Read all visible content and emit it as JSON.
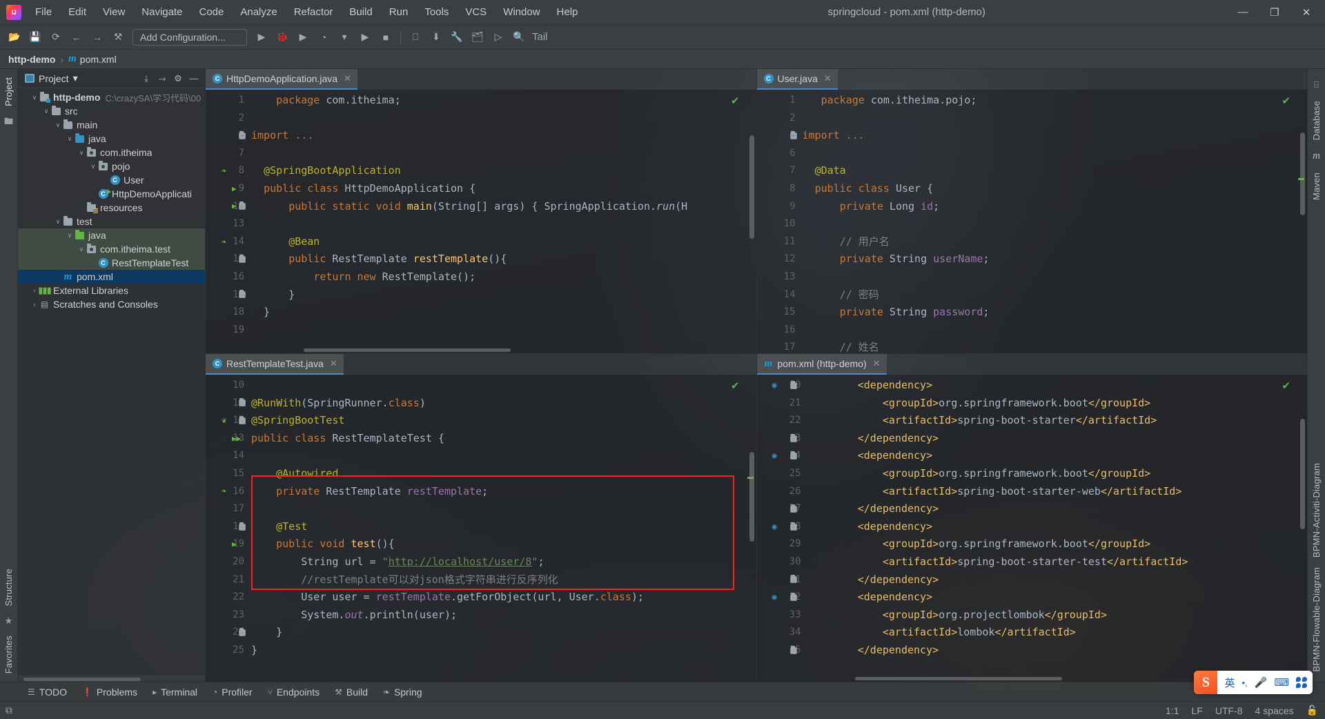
{
  "window": {
    "title": "springcloud - pom.xml (http-demo)",
    "logo_text": "IJ",
    "minimize": "—",
    "maximize": "❐",
    "close": "✕"
  },
  "menu": {
    "items": [
      "File",
      "Edit",
      "View",
      "Navigate",
      "Code",
      "Analyze",
      "Refactor",
      "Build",
      "Run",
      "Tools",
      "VCS",
      "Window",
      "Help"
    ]
  },
  "toolbar": {
    "icons": [
      {
        "name": "open-folder-icon",
        "glyph": "📂"
      },
      {
        "name": "save-all-icon",
        "glyph": "💾"
      },
      {
        "name": "sync-icon",
        "glyph": "⟳"
      },
      {
        "name": "back-icon",
        "glyph": "←"
      },
      {
        "name": "forward-icon",
        "glyph": "→"
      },
      {
        "name": "build-hammer-icon",
        "glyph": "⚒"
      }
    ],
    "config_label": "Add Configuration...",
    "run_icons": [
      {
        "name": "run-icon",
        "glyph": "▶"
      },
      {
        "name": "debug-icon",
        "glyph": "🐞"
      },
      {
        "name": "run-with-coverage-icon",
        "glyph": "▶"
      },
      {
        "name": "profile-icon",
        "glyph": "◔"
      },
      {
        "name": "dropdown-arrow-icon",
        "glyph": "▾"
      },
      {
        "name": "run-again-icon",
        "glyph": "▶"
      },
      {
        "name": "stop-icon",
        "glyph": "■"
      }
    ],
    "extra_icons": [
      {
        "name": "device-manager-icon",
        "glyph": "⎕"
      },
      {
        "name": "update-project-icon",
        "glyph": "⬇"
      },
      {
        "name": "settings-wrench-icon",
        "glyph": "🔧"
      },
      {
        "name": "project-structure-icon",
        "glyph": "🗂"
      },
      {
        "name": "terminal-icon",
        "glyph": "▷"
      },
      {
        "name": "search-everywhere-icon",
        "glyph": "🔍"
      }
    ],
    "tail_label": "Tail"
  },
  "breadcrumb": {
    "project": "http-demo",
    "separator": "›",
    "file": "pom.xml",
    "maven_glyph": "m"
  },
  "left_strip": {
    "top_label": "Project",
    "bottom_labels": [
      "Structure",
      "Favorites"
    ],
    "folder_icon": "🖿",
    "star_icon": "★"
  },
  "right_strip": {
    "labels": [
      "Database",
      "Maven",
      "BPMN-Activiti-Diagram",
      "BPMN-Flowable-Diagram"
    ],
    "database_icon": "⌸",
    "maven_glyph": "m"
  },
  "project_panel": {
    "title": "Project",
    "chevron": "▾",
    "actions": [
      {
        "name": "expand-all-icon",
        "glyph": "⤓"
      },
      {
        "name": "collapse-all-icon",
        "glyph": "⤑"
      },
      {
        "name": "settings-gear-icon",
        "glyph": "⚙"
      },
      {
        "name": "hide-panel-icon",
        "glyph": "—"
      }
    ],
    "tree": [
      {
        "label": "http-demo",
        "note": "C:\\crazySA\\学习代码\\00",
        "depth": 0,
        "arrow": "∨",
        "icon": "module-folder-icon",
        "bold": true,
        "state": "none"
      },
      {
        "label": "src",
        "note": "",
        "depth": 1,
        "arrow": "∨",
        "icon": "folder-icon",
        "bold": false,
        "state": "none"
      },
      {
        "label": "main",
        "note": "",
        "depth": 2,
        "arrow": "∨",
        "icon": "folder-icon",
        "bold": false,
        "state": "none"
      },
      {
        "label": "java",
        "note": "",
        "depth": 3,
        "arrow": "∨",
        "icon": "source-folder-icon",
        "bold": false,
        "state": "none"
      },
      {
        "label": "com.itheima",
        "note": "",
        "depth": 4,
        "arrow": "∨",
        "icon": "package-icon",
        "bold": false,
        "state": "none"
      },
      {
        "label": "pojo",
        "note": "",
        "depth": 5,
        "arrow": "∨",
        "icon": "package-icon",
        "bold": false,
        "state": "none"
      },
      {
        "label": "User",
        "note": "",
        "depth": 6,
        "arrow": "",
        "icon": "java-class-icon",
        "bold": false,
        "state": "none"
      },
      {
        "label": "HttpDemoApplicati",
        "note": "",
        "depth": 5,
        "arrow": "",
        "icon": "spring-boot-class-icon",
        "bold": false,
        "state": "none"
      },
      {
        "label": "resources",
        "note": "",
        "depth": 4,
        "arrow": "",
        "icon": "resources-folder-icon",
        "bold": false,
        "state": "none"
      },
      {
        "label": "test",
        "note": "",
        "depth": 2,
        "arrow": "∨",
        "icon": "folder-icon",
        "bold": false,
        "state": "none"
      },
      {
        "label": "java",
        "note": "",
        "depth": 3,
        "arrow": "∨",
        "icon": "test-source-folder-icon",
        "bold": false,
        "state": "green"
      },
      {
        "label": "com.itheima.test",
        "note": "",
        "depth": 4,
        "arrow": "∨",
        "icon": "package-icon",
        "bold": false,
        "state": "green"
      },
      {
        "label": "RestTemplateTest",
        "note": "",
        "depth": 5,
        "arrow": "",
        "icon": "java-test-class-icon",
        "bold": false,
        "state": "green"
      },
      {
        "label": "pom.xml",
        "note": "",
        "depth": 2,
        "arrow": "",
        "icon": "maven-pom-icon",
        "bold": false,
        "state": "blue"
      },
      {
        "label": "External Libraries",
        "note": "",
        "depth": 0,
        "arrow": "›",
        "icon": "external-libraries-icon",
        "bold": false,
        "state": "none"
      },
      {
        "label": "Scratches and Consoles",
        "note": "",
        "depth": 0,
        "arrow": "›",
        "icon": "scratches-icon",
        "bold": false,
        "state": "none"
      }
    ]
  },
  "editors": {
    "http_demo_application": {
      "tab": {
        "label": "HttpDemoApplication.java",
        "icon": "spring-boot-class-icon",
        "close": "✕"
      },
      "lines": [
        {
          "num": "1",
          "mark": "",
          "fold": "",
          "html": "    <span class='kw'>package</span> com.itheima;"
        },
        {
          "num": "2",
          "mark": "",
          "fold": "",
          "html": ""
        },
        {
          "num": "3",
          "mark": "",
          "fold": "+",
          "html": "<span class='kw'>import</span> <span class='cmt'>...</span>"
        },
        {
          "num": "7",
          "mark": "",
          "fold": "",
          "html": ""
        },
        {
          "num": "8",
          "mark": "bean",
          "fold": "",
          "html": "  <span class='ann'>@SpringBootApplication</span>"
        },
        {
          "num": "9",
          "mark": "run",
          "fold": "",
          "html": "  <span class='kw'>public class</span> <span class='xtxt'>HttpDemoApplication</span> {"
        },
        {
          "num": "10",
          "mark": "run",
          "fold": "+",
          "html": "      <span class='kw'>public static void</span> <span class='mth'>main</span>(String[] args) { SpringApplication.<span class='ital'>run</span>(H"
        },
        {
          "num": "13",
          "mark": "",
          "fold": "",
          "html": ""
        },
        {
          "num": "14",
          "mark": "bean",
          "fold": "",
          "html": "      <span class='ann'>@Bean</span>"
        },
        {
          "num": "15",
          "mark": "",
          "fold": "-",
          "html": "      <span class='kw'>public</span> RestTemplate <span class='mth'>restTemplate</span>(){"
        },
        {
          "num": "16",
          "mark": "",
          "fold": "",
          "html": "          <span class='kw'>return new</span> RestTemplate();"
        },
        {
          "num": "17",
          "mark": "",
          "fold": "-",
          "html": "      }"
        },
        {
          "num": "18",
          "mark": "",
          "fold": "",
          "html": "  }"
        },
        {
          "num": "19",
          "mark": "",
          "fold": "",
          "html": ""
        }
      ]
    },
    "user_java": {
      "tab": {
        "label": "User.java",
        "icon": "java-class-icon",
        "close": "✕"
      },
      "lines": [
        {
          "num": "1",
          "mark": "",
          "fold": "",
          "html": "   <span class='kw'>package</span> com.itheima.pojo;"
        },
        {
          "num": "2",
          "mark": "",
          "fold": "",
          "html": ""
        },
        {
          "num": "3",
          "mark": "",
          "fold": "+",
          "html": "<span class='kw'>import</span> <span class='cmt'>...</span>"
        },
        {
          "num": "6",
          "mark": "",
          "fold": "",
          "html": ""
        },
        {
          "num": "7",
          "mark": "",
          "fold": "",
          "html": "  <span class='ann'>@Data</span>"
        },
        {
          "num": "8",
          "mark": "",
          "fold": "",
          "html": "  <span class='kw'>public class</span> <span class='xtxt'>User</span> {"
        },
        {
          "num": "9",
          "mark": "",
          "fold": "",
          "html": "      <span class='kw'>private</span> Long <span class='fld'>id</span>;"
        },
        {
          "num": "10",
          "mark": "",
          "fold": "",
          "html": ""
        },
        {
          "num": "11",
          "mark": "",
          "fold": "",
          "html": "      <span class='cmt'>// 用户名</span>"
        },
        {
          "num": "12",
          "mark": "",
          "fold": "",
          "html": "      <span class='kw'>private</span> String <span class='fld'>userName</span>;"
        },
        {
          "num": "13",
          "mark": "",
          "fold": "",
          "html": ""
        },
        {
          "num": "14",
          "mark": "",
          "fold": "",
          "html": "      <span class='cmt'>// 密码</span>"
        },
        {
          "num": "15",
          "mark": "",
          "fold": "",
          "html": "      <span class='kw'>private</span> String <span class='fld'>password</span>;"
        },
        {
          "num": "16",
          "mark": "",
          "fold": "",
          "html": ""
        },
        {
          "num": "17",
          "mark": "",
          "fold": "",
          "html": "      <span class='cmt'>// 姓名</span>"
        }
      ]
    },
    "rest_template_test": {
      "tab": {
        "label": "RestTemplateTest.java",
        "icon": "java-test-class-icon",
        "close": "✕"
      },
      "lines": [
        {
          "num": "10",
          "mark": "",
          "fold": "",
          "html": ""
        },
        {
          "num": "11",
          "mark": "",
          "fold": "-",
          "html": "<span class='ann'>@RunWith</span>(SpringRunner.<span class='kw'>class</span>)"
        },
        {
          "num": "12",
          "mark": "leaf",
          "fold": "-",
          "html": "<span class='ann'>@SpringBootTest</span>"
        },
        {
          "num": "13",
          "mark": "runall",
          "fold": "",
          "html": "<span class='kw'>public class</span> <span class='xtxt'>RestTemplateTest</span> {"
        },
        {
          "num": "14",
          "mark": "",
          "fold": "",
          "html": ""
        },
        {
          "num": "15",
          "mark": "",
          "fold": "",
          "html": "    <span class='ann'>@Autowired</span>"
        },
        {
          "num": "16",
          "mark": "bean",
          "fold": "",
          "html": "    <span class='kw'>private</span> RestTemplate <span class='fld'>restTemplate</span>;"
        },
        {
          "num": "17",
          "mark": "",
          "fold": "",
          "html": ""
        },
        {
          "num": "18",
          "mark": "",
          "fold": "-",
          "html": "    <span class='ann'>@Test</span>"
        },
        {
          "num": "19",
          "mark": "run",
          "fold": "",
          "html": "    <span class='kw'>public void</span> <span class='mth'>test</span>(){"
        },
        {
          "num": "20",
          "mark": "",
          "fold": "",
          "html": "        String url = <span class='str'>\"</span><span class='link'>http://localhost/user/8</span><span class='str'>\"</span>;"
        },
        {
          "num": "21",
          "mark": "",
          "fold": "",
          "html": "        <span class='cmt'>//restTemplate可以对json格式字符串进行反序列化</span>"
        },
        {
          "num": "22",
          "mark": "",
          "fold": "",
          "html": "        User user = <span class='fld'>restTemplate</span>.getForObject(url, User.<span class='kw'>class</span>);"
        },
        {
          "num": "23",
          "mark": "",
          "fold": "",
          "html": "        System.<span class='fld ital'>out</span>.println(user);"
        },
        {
          "num": "24",
          "mark": "",
          "fold": "-",
          "html": "    }"
        },
        {
          "num": "25",
          "mark": "",
          "fold": "",
          "html": "}"
        }
      ]
    },
    "pom_xml": {
      "tab": {
        "label": "pom.xml (http-demo)",
        "icon": "maven-pom-icon",
        "close": "✕"
      },
      "lines": [
        {
          "num": "20",
          "mark": "mvn",
          "fold": "-",
          "html": "        <span class='xtag'>&lt;dependency&gt;</span>"
        },
        {
          "num": "21",
          "mark": "",
          "fold": "",
          "html": "            <span class='xtag'>&lt;groupId&gt;</span><span class='xtxt'>org.springframework.boot</span><span class='xtag'>&lt;/groupId&gt;</span>"
        },
        {
          "num": "22",
          "mark": "",
          "fold": "",
          "html": "            <span class='xtag'>&lt;artifactId&gt;</span><span class='xtxt'>spring-boot-starter</span><span class='xtag'>&lt;/artifactId&gt;</span>"
        },
        {
          "num": "23",
          "mark": "",
          "fold": "-",
          "html": "        <span class='xtag'>&lt;/dependency&gt;</span>"
        },
        {
          "num": "24",
          "mark": "mvn",
          "fold": "-",
          "html": "        <span class='xtag'>&lt;dependency&gt;</span>"
        },
        {
          "num": "25",
          "mark": "",
          "fold": "",
          "html": "            <span class='xtag'>&lt;groupId&gt;</span><span class='xtxt'>org.springframework.boot</span><span class='xtag'>&lt;/groupId&gt;</span>"
        },
        {
          "num": "26",
          "mark": "",
          "fold": "",
          "html": "            <span class='xtag'>&lt;artifactId&gt;</span><span class='xtxt'>spring-boot-starter-web</span><span class='xtag'>&lt;/artifactId&gt;</span>"
        },
        {
          "num": "27",
          "mark": "",
          "fold": "-",
          "html": "        <span class='xtag'>&lt;/dependency&gt;</span>"
        },
        {
          "num": "28",
          "mark": "mvn",
          "fold": "-",
          "html": "        <span class='xtag'>&lt;dependency&gt;</span>"
        },
        {
          "num": "29",
          "mark": "",
          "fold": "",
          "html": "            <span class='xtag'>&lt;groupId&gt;</span><span class='xtxt'>org.springframework.boot</span><span class='xtag'>&lt;/groupId&gt;</span>"
        },
        {
          "num": "30",
          "mark": "",
          "fold": "",
          "html": "            <span class='xtag'>&lt;artifactId&gt;</span><span class='xtxt'>spring-boot-starter-test</span><span class='xtag'>&lt;/artifactId&gt;</span>"
        },
        {
          "num": "31",
          "mark": "",
          "fold": "-",
          "html": "        <span class='xtag'>&lt;/dependency&gt;</span>"
        },
        {
          "num": "32",
          "mark": "mvn",
          "fold": "-",
          "html": "        <span class='xtag'>&lt;dependency&gt;</span>"
        },
        {
          "num": "33",
          "mark": "",
          "fold": "",
          "html": "            <span class='xtag'>&lt;groupId&gt;</span><span class='xtxt'>org.projectlombok</span><span class='xtag'>&lt;/groupId&gt;</span>"
        },
        {
          "num": "34",
          "mark": "",
          "fold": "",
          "html": "            <span class='xtag'>&lt;artifactId&gt;</span><span class='xtxt'>lombok</span><span class='xtag'>&lt;/artifactId&gt;</span>"
        },
        {
          "num": "35",
          "mark": "",
          "fold": "-",
          "html": "        <span class='xtag'>&lt;/dependency&gt;</span>"
        }
      ]
    },
    "inspection_ok_glyph": "✔"
  },
  "bottom_tools": [
    {
      "label": "TODO",
      "icon": "todo-list-icon",
      "glyph": "☰"
    },
    {
      "label": "Problems",
      "icon": "problems-icon",
      "glyph": "❗"
    },
    {
      "label": "Terminal",
      "icon": "terminal-icon",
      "glyph": "▸"
    },
    {
      "label": "Profiler",
      "icon": "profiler-icon",
      "glyph": "◔"
    },
    {
      "label": "Endpoints",
      "icon": "endpoints-icon",
      "glyph": "⑂"
    },
    {
      "label": "Build",
      "icon": "build-hammer-icon",
      "glyph": "⚒"
    },
    {
      "label": "Spring",
      "icon": "spring-leaf-icon",
      "glyph": "❧"
    }
  ],
  "statusbar": {
    "left_icon": "event-log-icon",
    "left_glyph": "⧉",
    "caret": "1:1",
    "line_separator": "LF",
    "encoding": "UTF-8",
    "indent": "4 spaces",
    "lock_icon": "unlocked-icon",
    "lock_glyph": "🔓"
  },
  "ime": {
    "logo": "S",
    "mode": "英",
    "punctuation": "•,",
    "mic_icon": "🎤",
    "keyboard_icon": "⌨",
    "menu_icon": "grid-icon"
  }
}
